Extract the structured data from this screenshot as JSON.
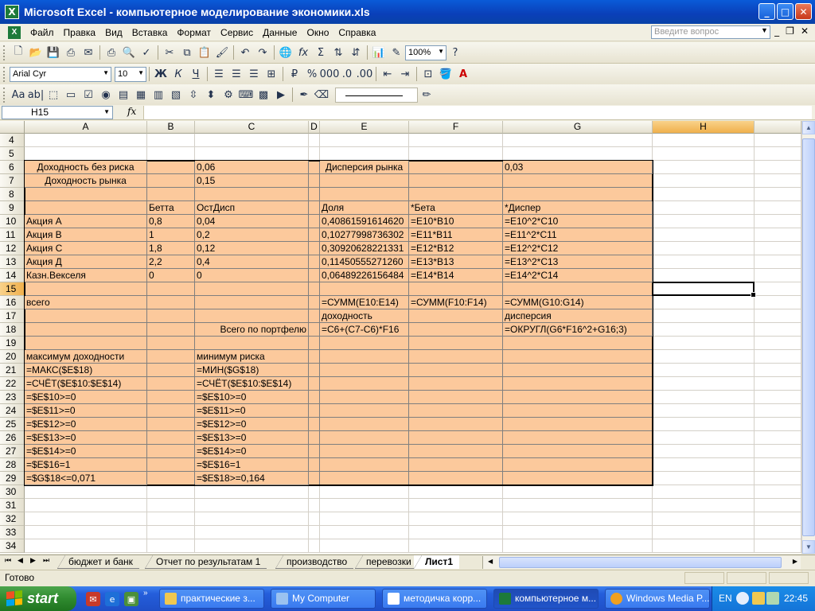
{
  "window": {
    "title": "Microsoft Excel - компьютерное моделирование экономики.xls"
  },
  "menu": {
    "items": [
      "Файл",
      "Правка",
      "Вид",
      "Вставка",
      "Формат",
      "Сервис",
      "Данные",
      "Окно",
      "Справка"
    ],
    "ask_placeholder": "Введите вопрос"
  },
  "toolbar": {
    "zoom": "100%",
    "font": "Arial Cyr",
    "font_size": "10",
    "bold_label": "Ж",
    "italic_label": "К",
    "underline_label": "Ч"
  },
  "formula_bar": {
    "name_box": "H15",
    "fx": "fx",
    "content": ""
  },
  "sheet": {
    "columns": [
      "A",
      "B",
      "C",
      "D",
      "E",
      "F",
      "G",
      "H"
    ],
    "selected_column": "H",
    "selected_row": "15",
    "rows": [
      {
        "n": "4",
        "cells": {}
      },
      {
        "n": "5",
        "cells": {}
      },
      {
        "n": "6",
        "cells": {
          "A": "Доходность без риска",
          "C": "0,06",
          "E": "Дисперсия рынка",
          "G": "0,03"
        }
      },
      {
        "n": "7",
        "cells": {
          "A": "Доходность рынка",
          "C": "0,15"
        }
      },
      {
        "n": "8",
        "cells": {}
      },
      {
        "n": "9",
        "cells": {
          "B": "Бетта",
          "C": "ОстДисп",
          "E": "Доля",
          "F": "*Бета",
          "G": "*Диспер"
        }
      },
      {
        "n": "10",
        "cells": {
          "A": "Акция А",
          "B": "0,8",
          "C": "0,04",
          "E": "0,40861591614620",
          "F": "=E10*B10",
          "G": "=E10^2*C10"
        }
      },
      {
        "n": "11",
        "cells": {
          "A": "Акция В",
          "B": "1",
          "C": "0,2",
          "E": "0,10277998736302",
          "F": "=E11*B11",
          "G": "=E11^2*C11"
        }
      },
      {
        "n": "12",
        "cells": {
          "A": "Акция С",
          "B": "1,8",
          "C": "0,12",
          "E": "0,30920628221331",
          "F": "=E12*B12",
          "G": "=E12^2*C12"
        }
      },
      {
        "n": "13",
        "cells": {
          "A": "Акция Д",
          "B": "2,2",
          "C": "0,4",
          "E": "0,11450555271260",
          "F": "=E13*B13",
          "G": "=E13^2*C13"
        }
      },
      {
        "n": "14",
        "cells": {
          "A": "Казн.Векселя",
          "B": "0",
          "C": "0",
          "E": "0,06489226156484",
          "F": "=E14*B14",
          "G": "=E14^2*C14"
        }
      },
      {
        "n": "15",
        "cells": {}
      },
      {
        "n": "16",
        "cells": {
          "A": "всего",
          "E": "=СУММ(E10:E14)",
          "F": "=СУММ(F10:F14)",
          "G": "=СУММ(G10:G14)"
        }
      },
      {
        "n": "17",
        "cells": {
          "E": "доходность",
          "G": "дисперсия"
        }
      },
      {
        "n": "18",
        "cells": {
          "C": "Всего по портфелю",
          "E": "=C6+(C7-C6)*F16",
          "G": "=ОКРУГЛ(G6*F16^2+G16;3)"
        }
      },
      {
        "n": "19",
        "cells": {}
      },
      {
        "n": "20",
        "cells": {
          "A": "максимум доходности",
          "C": "минимум риска"
        }
      },
      {
        "n": "21",
        "cells": {
          "A": "=МАКС($E$18)",
          "C": "=МИН($G$18)"
        }
      },
      {
        "n": "22",
        "cells": {
          "A": "=СЧЁТ($E$10:$E$14)",
          "C": "=СЧЁТ($E$10:$E$14)"
        }
      },
      {
        "n": "23",
        "cells": {
          "A": "=$E$10>=0",
          "C": "=$E$10>=0"
        }
      },
      {
        "n": "24",
        "cells": {
          "A": "=$E$11>=0",
          "C": "=$E$11>=0"
        }
      },
      {
        "n": "25",
        "cells": {
          "A": "=$E$12>=0",
          "C": "=$E$12>=0"
        }
      },
      {
        "n": "26",
        "cells": {
          "A": "=$E$13>=0",
          "C": "=$E$13>=0"
        }
      },
      {
        "n": "27",
        "cells": {
          "A": "=$E$14>=0",
          "C": "=$E$14>=0"
        }
      },
      {
        "n": "28",
        "cells": {
          "A": "=$E$16=1",
          "C": "=$E$16=1"
        }
      },
      {
        "n": "29",
        "cells": {
          "A": "=$G$18<=0,071",
          "C": "=$E$18>=0,164"
        }
      },
      {
        "n": "30",
        "cells": {}
      },
      {
        "n": "31",
        "cells": {}
      },
      {
        "n": "32",
        "cells": {}
      },
      {
        "n": "33",
        "cells": {}
      },
      {
        "n": "34",
        "cells": {}
      }
    ],
    "fill_color": "#fcc99c"
  },
  "sheet_tabs": {
    "tabs": [
      "бюджет и банк",
      "Отчет по результатам 1",
      "производство",
      "перевозки",
      "Лист1"
    ],
    "active": "Лист1"
  },
  "status": {
    "text": "Готово"
  },
  "taskbar": {
    "start_label": "start",
    "buttons": [
      "практические з...",
      "My Computer",
      "методичка корр...",
      "компьютерное м...",
      "Windows Media P..."
    ],
    "active_button": "компьютерное м...",
    "lang": "EN",
    "time": "22:45"
  }
}
